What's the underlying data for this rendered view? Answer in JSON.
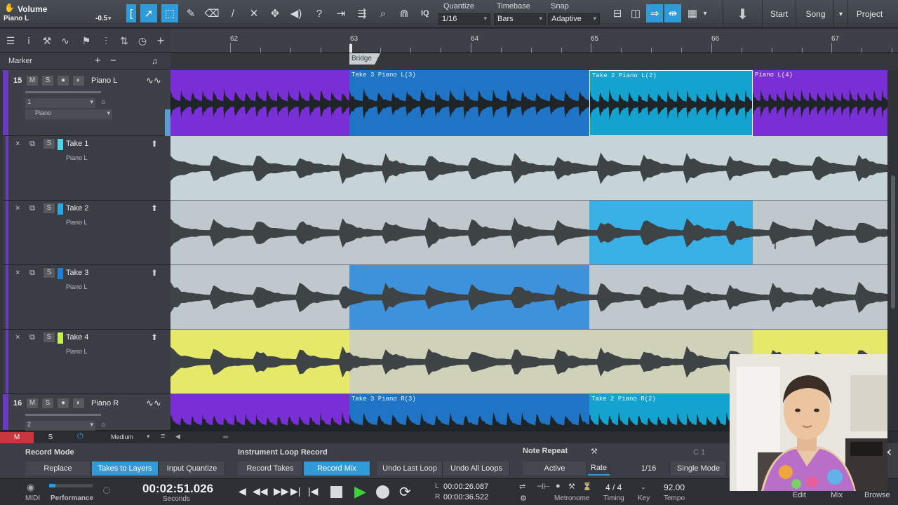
{
  "toolbar": {
    "track_title": "Volume",
    "track_sub": "Piano L",
    "track_value": "-0.5",
    "quantize_label": "Quantize",
    "quantize_value": "1/16",
    "timebase_label": "Timebase",
    "timebase_value": "Bars",
    "snap_label": "Snap",
    "snap_value": "Adaptive",
    "iq_label": "IQ",
    "start_label": "Start",
    "song_label": "Song",
    "project_label": "Project"
  },
  "left": {
    "marker_label": "Marker"
  },
  "tracks": [
    {
      "num": "15",
      "name": "Piano L",
      "channel": "1",
      "instrument": "Piano"
    },
    {
      "num": "16",
      "name": "Piano R",
      "channel": "2",
      "instrument": ""
    }
  ],
  "takes": [
    {
      "name": "Take 1",
      "sub": "Piano L",
      "color": "#4fd4ea"
    },
    {
      "name": "Take 2",
      "sub": "Piano L",
      "color": "#2aa6e2"
    },
    {
      "name": "Take 3",
      "sub": "Piano L",
      "color": "#1f7ed6"
    },
    {
      "name": "Take 4",
      "sub": "Piano L",
      "color": "#c8f04a"
    }
  ],
  "ruler": {
    "bars": [
      "62",
      "63",
      "64",
      "65",
      "66",
      "67"
    ],
    "marker": "Bridge"
  },
  "clips": {
    "track15": [
      "Take 3 Piano L(3)",
      "Take 2 Piano L(2)",
      "Piano L(4)"
    ],
    "track16": [
      "Take 3 Piano R(3)",
      "Take 2 Piano R(2)"
    ]
  },
  "bottom": {
    "m_label": "M",
    "s_label": "S",
    "zoom_label": "Medium",
    "record_mode_title": "Record Mode",
    "record_mode_buttons": [
      "Replace",
      "Takes to Layers",
      "Input Quantize"
    ],
    "loop_title": "Instrument Loop Record",
    "loop_buttons": [
      "Record Takes",
      "Record Mix",
      "Undo Last Loop",
      "Undo All Loops"
    ],
    "note_repeat_title": "Note Repeat",
    "note_repeat_note": "C 1",
    "note_repeat_buttons": [
      "Active",
      "Rate",
      "1/16",
      "Single Mode"
    ]
  },
  "transport": {
    "midi_label": "MIDI",
    "performance_label": "Performance",
    "time": "00:02:51.026",
    "time_unit": "Seconds",
    "loop_l_label": "L",
    "loop_l": "00:00:26.087",
    "loop_r_label": "R",
    "loop_r": "00:00:36.522",
    "metronome_label": "Metronome",
    "timing_value": "4 / 4",
    "timing_label": "Timing",
    "key_value": "-",
    "key_label": "Key",
    "tempo_value": "92.00",
    "tempo_label": "Tempo",
    "edit_label": "Edit",
    "mix_label": "Mix",
    "browse_label": "Browse"
  },
  "colors": {
    "accent": "#2f9bd8",
    "track_purple": "#7a2fd6",
    "take1": "#4fd4ea",
    "take2": "#2aa6e2",
    "take3": "#1f7ed6",
    "take4": "#e8ea6a"
  }
}
